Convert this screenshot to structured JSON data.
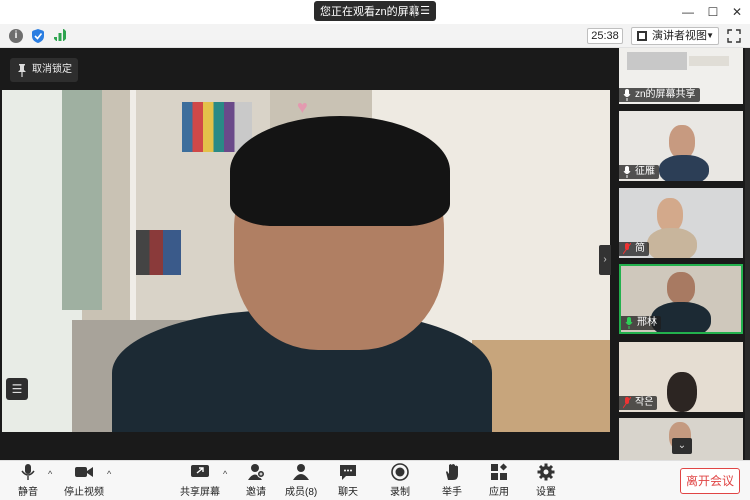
{
  "titlebar": {
    "share_text": "您正在观看zn的屏幕"
  },
  "toolbar": {
    "timer": "25:38",
    "view_label": "演讲者视图"
  },
  "stage": {
    "pin_label": "取消锁定"
  },
  "gallery": {
    "tiles": [
      {
        "label": "zn的屏幕共享"
      },
      {
        "label": "征雁"
      },
      {
        "label": "简"
      },
      {
        "label": "邢林"
      },
      {
        "label": "작은"
      }
    ]
  },
  "bottombar": {
    "mute": "静音",
    "stop_video": "停止视频",
    "share_screen": "共享屏幕",
    "invite": "邀请",
    "members": "成员(8)",
    "chat": "聊天",
    "record": "录制",
    "raise_hand": "举手",
    "apps": "应用",
    "settings": "设置",
    "leave": "离开会议"
  },
  "colors": {
    "active_speaker": "#23b14d",
    "leave": "#e04545",
    "dark_bg": "#1a1a1a"
  }
}
